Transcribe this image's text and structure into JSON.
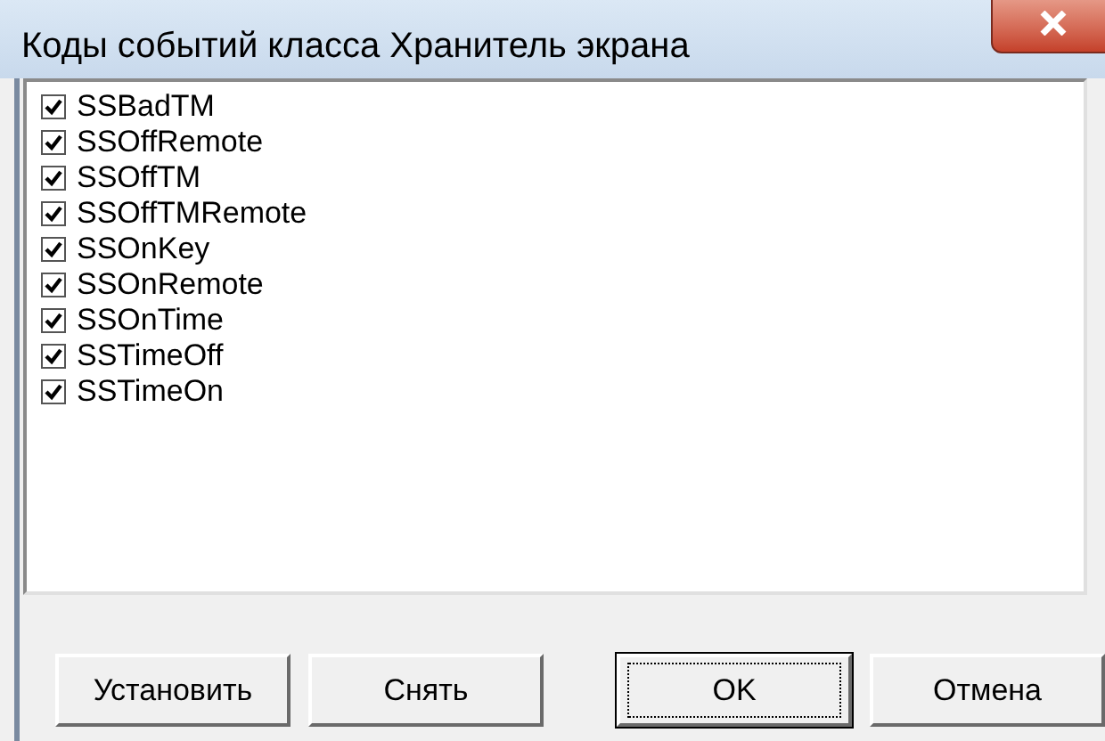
{
  "window": {
    "title": "Коды событий класса Хранитель экрана"
  },
  "events": [
    {
      "label": "SSBadTM",
      "checked": true
    },
    {
      "label": "SSOffRemote",
      "checked": true
    },
    {
      "label": "SSOffTM",
      "checked": true
    },
    {
      "label": "SSOffTMRemote",
      "checked": true
    },
    {
      "label": "SSOnKey",
      "checked": true
    },
    {
      "label": "SSOnRemote",
      "checked": true
    },
    {
      "label": "SSOnTime",
      "checked": true
    },
    {
      "label": "SSTimeOff",
      "checked": true
    },
    {
      "label": "SSTimeOn",
      "checked": true
    }
  ],
  "buttons": [
    {
      "label": "Установить",
      "focused": false
    },
    {
      "label": "Снять",
      "focused": false
    },
    {
      "label": "OK",
      "focused": true
    },
    {
      "label": "Отмена",
      "focused": false
    }
  ]
}
